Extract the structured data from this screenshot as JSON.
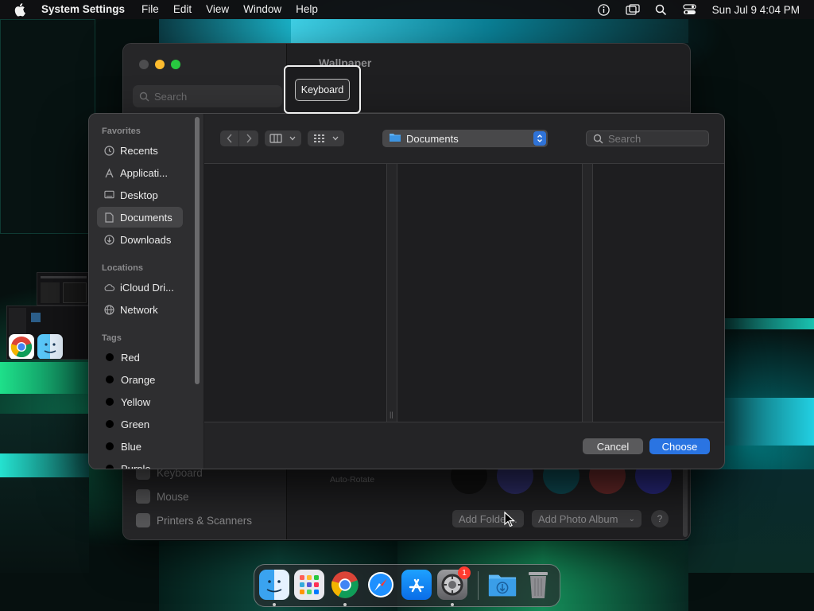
{
  "menubar": {
    "app_name": "System Settings",
    "items": [
      "File",
      "Edit",
      "View",
      "Window",
      "Help"
    ],
    "status_icons": [
      "accessibility-icon",
      "screen-mirroring-icon",
      "spotlight-icon",
      "control-center-icon"
    ],
    "clock": "Sun Jul 9  4:04 PM"
  },
  "settings_window": {
    "title": "Wallpaper",
    "search_placeholder": "Search",
    "sidebar_items": [
      "Keyboard",
      "Mouse",
      "Printers & Scanners"
    ],
    "auto_rotate": "Auto-Rotate",
    "add_folder": "Add Folder...",
    "add_photo_album": "Add Photo Album",
    "help": "?"
  },
  "tooltip": {
    "label": "Keyboard"
  },
  "sheet": {
    "sidebar": {
      "favorites_title": "Favorites",
      "favorites": [
        {
          "label": "Recents",
          "icon": "clock-icon"
        },
        {
          "label": "Applicati...",
          "icon": "applications-icon"
        },
        {
          "label": "Desktop",
          "icon": "desktop-icon"
        },
        {
          "label": "Documents",
          "icon": "document-icon"
        },
        {
          "label": "Downloads",
          "icon": "download-icon"
        }
      ],
      "locations_title": "Locations",
      "locations": [
        {
          "label": "iCloud Dri...",
          "icon": "cloud-icon"
        },
        {
          "label": "Network",
          "icon": "network-icon"
        }
      ],
      "tags_title": "Tags",
      "tags": [
        "Red",
        "Orange",
        "Yellow",
        "Green",
        "Blue",
        "Purple"
      ],
      "selected": "Documents"
    },
    "location": "Documents",
    "search_placeholder": "Search",
    "cancel_label": "Cancel",
    "choose_label": "Choose"
  },
  "dock": {
    "apps": [
      "Finder",
      "Launchpad",
      "Chrome",
      "Safari",
      "App Store",
      "System Settings",
      "Downloads",
      "Trash"
    ],
    "settings_badge": "1"
  },
  "colors": {
    "accent": "#2a74e2",
    "stepper": "#2f73d8",
    "traffic_min": "#febc2e",
    "traffic_max": "#28c840",
    "badge": "#ff3b30"
  }
}
